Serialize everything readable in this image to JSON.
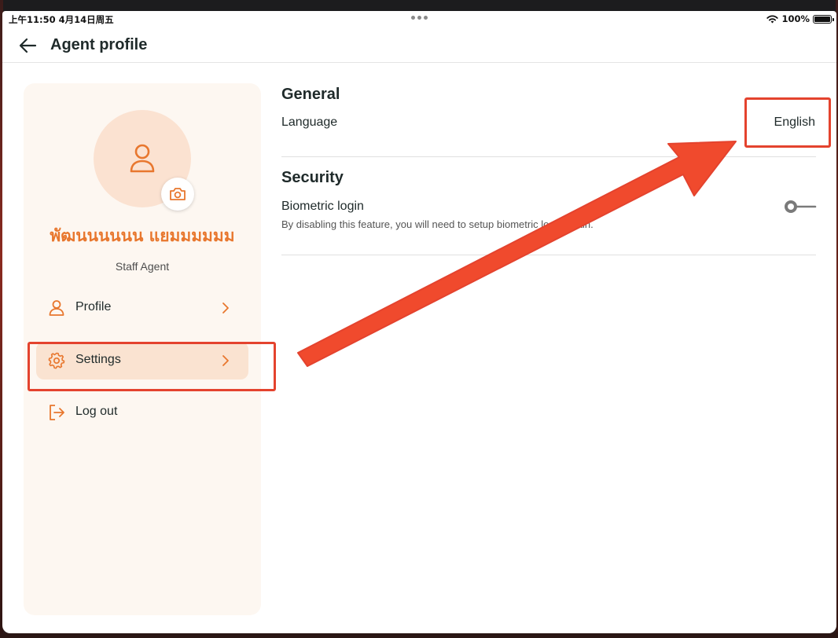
{
  "status_bar": {
    "time": "上午11:50   4月14日周五",
    "battery": "100%"
  },
  "header": {
    "title": "Agent profile",
    "back_icon": "arrow-left-icon"
  },
  "profile": {
    "name": "พัฒนนนนนน แยมมมมมม",
    "role": "Staff Agent",
    "avatar_icon": "person-icon",
    "camera_icon": "camera-icon"
  },
  "sidebar": {
    "items": [
      {
        "label": "Profile",
        "icon": "user-icon",
        "active": false
      },
      {
        "label": "Settings",
        "icon": "gear-icon",
        "active": true
      },
      {
        "label": "Log out",
        "icon": "logout-icon",
        "active": false
      }
    ]
  },
  "general": {
    "title": "General",
    "language_label": "Language",
    "language_value": "English"
  },
  "security": {
    "title": "Security",
    "biometric_label": "Biometric login",
    "biometric_desc": "By disabling this feature, you will need to setup biometric login again.",
    "biometric_enabled": false
  },
  "colors": {
    "accent": "#E8772E",
    "accent_light": "#FAE3D1",
    "sidebar_bg": "#FDF7F1",
    "annotation": "#E4432E",
    "text": "#1F2A2A"
  }
}
